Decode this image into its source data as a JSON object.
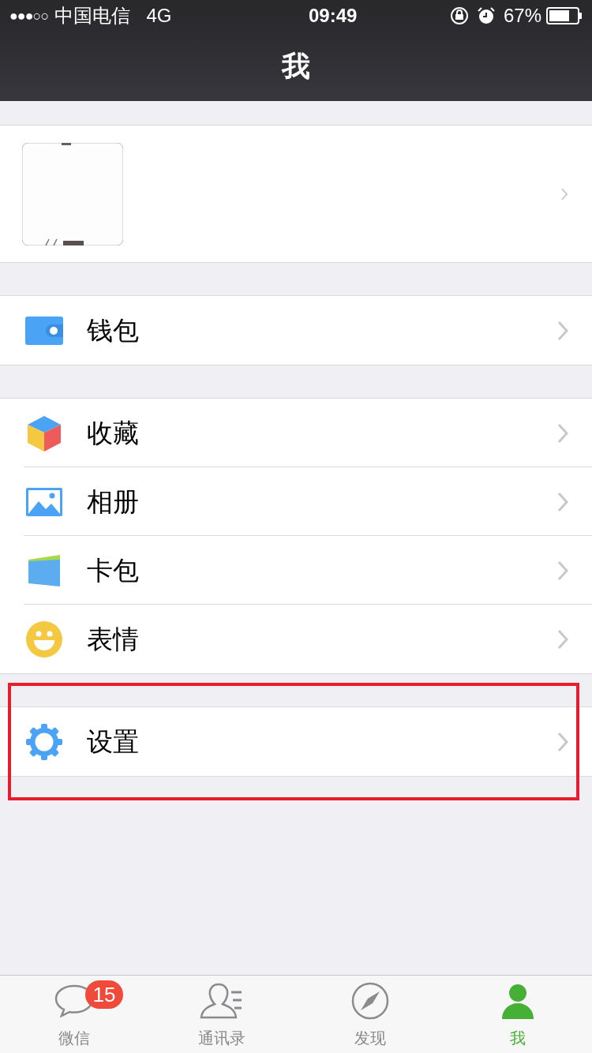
{
  "status_bar": {
    "signal": "●●●○○",
    "carrier": "中国电信",
    "network": "4G",
    "time": "09:49",
    "battery_percent": "67%"
  },
  "nav_bar": {
    "title": "我"
  },
  "groups": [
    {
      "items": [
        {
          "kind": "wallet",
          "label": "钱包",
          "highlighted": false
        }
      ]
    },
    {
      "items": [
        {
          "kind": "favorites",
          "label": "收藏",
          "highlighted": false
        },
        {
          "kind": "album",
          "label": "相册",
          "highlighted": false
        },
        {
          "kind": "cards",
          "label": "卡包",
          "highlighted": false
        },
        {
          "kind": "stickers",
          "label": "表情",
          "highlighted": false
        }
      ]
    },
    {
      "items": [
        {
          "kind": "settings",
          "label": "设置",
          "highlighted": true
        }
      ]
    }
  ],
  "tab_bar": [
    {
      "kind": "chats",
      "label": "微信",
      "badge": "15",
      "selected": false
    },
    {
      "kind": "contacts",
      "label": "通讯录",
      "selected": false
    },
    {
      "kind": "discover",
      "label": "发现",
      "selected": false
    },
    {
      "kind": "me",
      "label": "我",
      "selected": true
    }
  ]
}
